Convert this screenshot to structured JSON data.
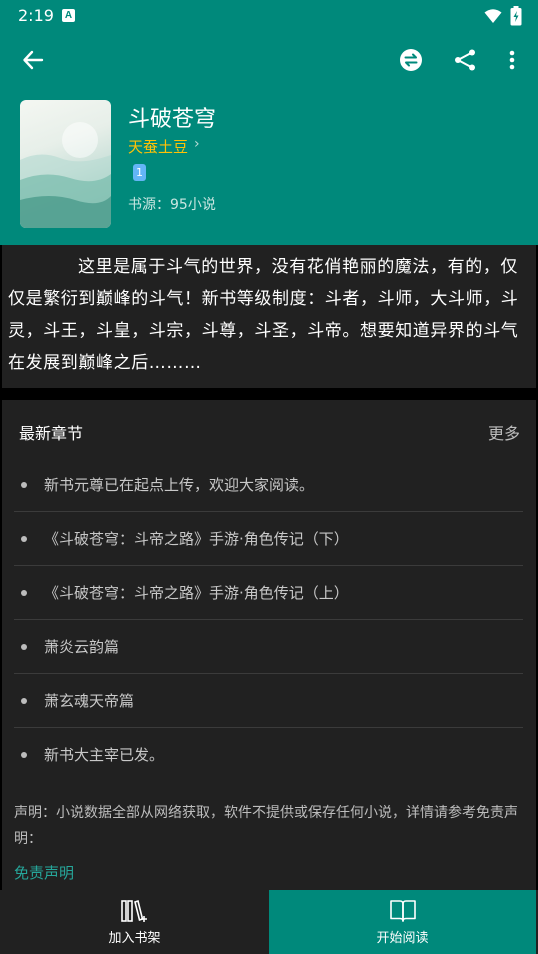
{
  "status_bar": {
    "time": "2:19",
    "notification_letter": "A"
  },
  "toolbar": {
    "back_icon": "arrow-left-icon",
    "change_source_icon": "swap-icon",
    "share_icon": "share-icon",
    "more_icon": "more-vert-icon"
  },
  "book": {
    "title": "斗破苍穹",
    "author": "天蚕土豆",
    "author_chevron": "›",
    "badge": "1",
    "source": "书源：95小说"
  },
  "intro": "这里是属于斗气的世界，没有花俏艳丽的魔法，有的，仅仅是繁衍到巅峰的斗气！新书等级制度：斗者，斗师，大斗师，斗灵，斗王，斗皇，斗宗，斗尊，斗圣，斗帝。想要知道异界的斗气在发展到巅峰之后………",
  "chapters": {
    "title": "最新章节",
    "more_label": "更多",
    "items": [
      "新书元尊已在起点上传，欢迎大家阅读。",
      "《斗破苍穹：斗帝之路》手游·角色传记（下）",
      "《斗破苍穹：斗帝之路》手游·角色传记（上）",
      "萧炎云韵篇",
      "萧玄魂天帝篇",
      "新书大主宰已发。"
    ]
  },
  "disclaimer": {
    "text": "声明：小说数据全部从网络获取，软件不提供或保存任何小说，详情请参考免责声明：",
    "link": "免责声明"
  },
  "bottom_bar": {
    "add_shelf_label": "加入书架",
    "start_reading_label": "开始阅读"
  },
  "colors": {
    "primary": "#00897B",
    "surface": "#212121",
    "author": "#FFC107",
    "link": "#26A69A",
    "badge": "#64B5F6"
  }
}
